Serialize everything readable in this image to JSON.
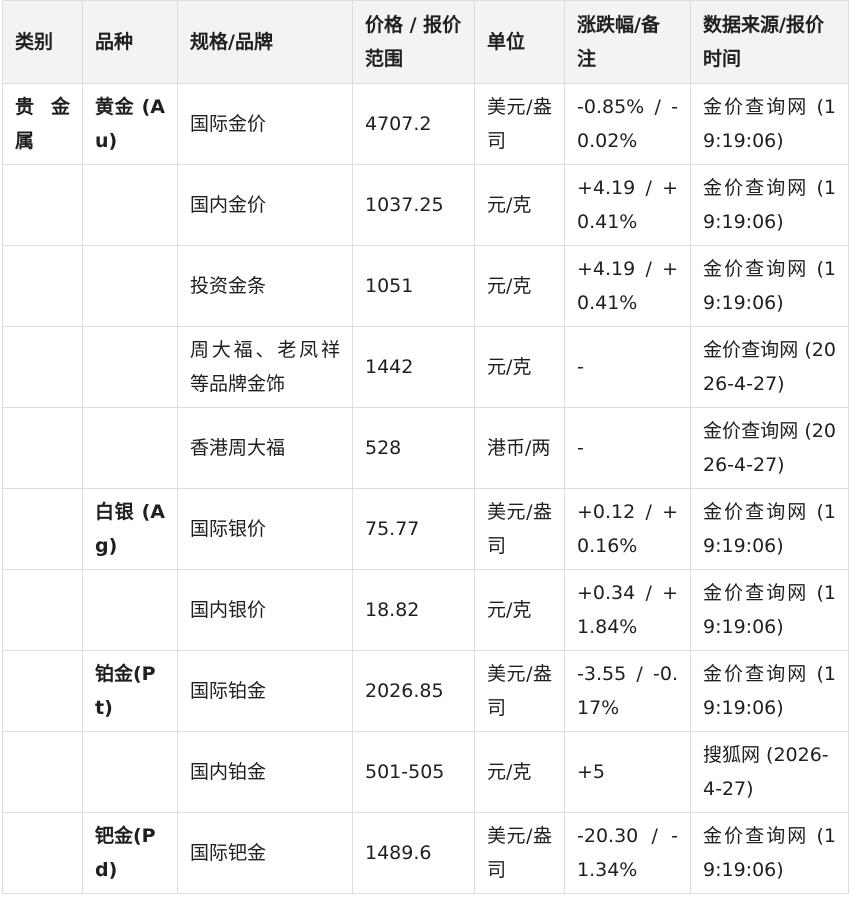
{
  "table": {
    "headers": [
      "类别",
      "品种",
      "规格/品牌",
      "价格 / 报价范围",
      "单位",
      "涨跌幅/备注",
      "数据来源/报价时间"
    ],
    "rows": [
      [
        "贵金属",
        "黄金 (Au)",
        "国际金价",
        "4707.2",
        "美元/盎司",
        "-0.85% / -0.02%",
        "金价查询网 (19:19:06)"
      ],
      [
        "",
        "",
        "国内金价",
        "1037.25",
        "元/克",
        "+4.19 / +0.41%",
        "金价查询网 (19:19:06)"
      ],
      [
        "",
        "",
        "投资金条",
        "1051",
        "元/克",
        "+4.19 / +0.41%",
        "金价查询网 (19:19:06)"
      ],
      [
        "",
        "",
        "周大福、老凤祥等品牌金饰",
        "1442",
        "元/克",
        "-",
        "金价查询网 (2026-4-27)"
      ],
      [
        "",
        "",
        "香港周大福",
        "528",
        "港币/两",
        "-",
        "金价查询网 (2026-4-27)"
      ],
      [
        "",
        "白银 (Ag)",
        "国际银价",
        "75.77",
        "美元/盎司",
        "+0.12 / +0.16%",
        "金价查询网 (19:19:06)"
      ],
      [
        "",
        "",
        "国内银价",
        "18.82",
        "元/克",
        "+0.34 / +1.84%",
        "金价查询网 (19:19:06)"
      ],
      [
        "",
        "铂金(Pt)",
        "国际铂金",
        "2026.85",
        "美元/盎司",
        "-3.55 / -0.17%",
        "金价查询网 (19:19:06)"
      ],
      [
        "",
        "",
        "国内铂金",
        "501-505",
        "元/克",
        "+5",
        "搜狐网 (2026-4-27)"
      ],
      [
        "",
        "钯金(Pd)",
        "国际钯金",
        "1489.6",
        "美元/盎司",
        "-20.30 / -1.34%",
        "金价查询网 (19:19:06)"
      ]
    ]
  }
}
